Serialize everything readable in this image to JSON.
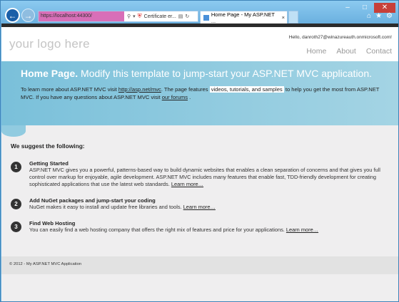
{
  "browser": {
    "address_url": "https://localhost:44300/",
    "cert_error": "Certificate er...",
    "tab_title": "Home Page - My ASP.NET ...",
    "tab_close": "×",
    "back_glyph": "←",
    "forward_glyph": "→",
    "minimize_glyph": "–",
    "maximize_glyph": "□",
    "close_glyph": "✕",
    "home_glyph": "⌂",
    "favorites_glyph": "★",
    "settings_glyph": "⚙"
  },
  "header": {
    "logo": "your logo here",
    "login": "Hello, danroth27@winazureauth.onmicrosoft.com!",
    "nav": [
      "Home",
      "About",
      "Contact"
    ]
  },
  "featured": {
    "title_bold": "Home Page.",
    "title_rest": "Modify this template to jump-start your ASP.NET MVC application.",
    "text_1": "To learn more about ASP.NET MVC visit",
    "link_mvc": "http://asp.net/mvc",
    "text_2": ". The page features",
    "highlight": "videos, tutorials, and samples",
    "text_3": "to help you get the most from ASP.NET MVC. If you have any questions about ASP.NET MVC visit",
    "link_forums": "our forums",
    "text_4": "."
  },
  "main": {
    "heading": "We suggest the following:",
    "steps": [
      {
        "num": "1",
        "title": "Getting Started",
        "desc": "ASP.NET MVC gives you a powerful, patterns-based way to build dynamic websites that enables a clean separation of concerns and that gives you full control over markup for enjoyable, agile development. ASP.NET MVC includes many features that enable fast, TDD-friendly development for creating sophisticated applications that use the latest web standards.",
        "link": "Learn more…"
      },
      {
        "num": "2",
        "title": "Add NuGet packages and jump-start your coding",
        "desc": "NuGet makes it easy to install and update free libraries and tools.",
        "link": "Learn more…"
      },
      {
        "num": "3",
        "title": "Find Web Hosting",
        "desc": "You can easily find a web hosting company that offers the right mix of features and price for your applications.",
        "link": "Learn more…"
      }
    ]
  },
  "footer": {
    "text": "© 2012 - My ASP.NET MVC Application"
  }
}
